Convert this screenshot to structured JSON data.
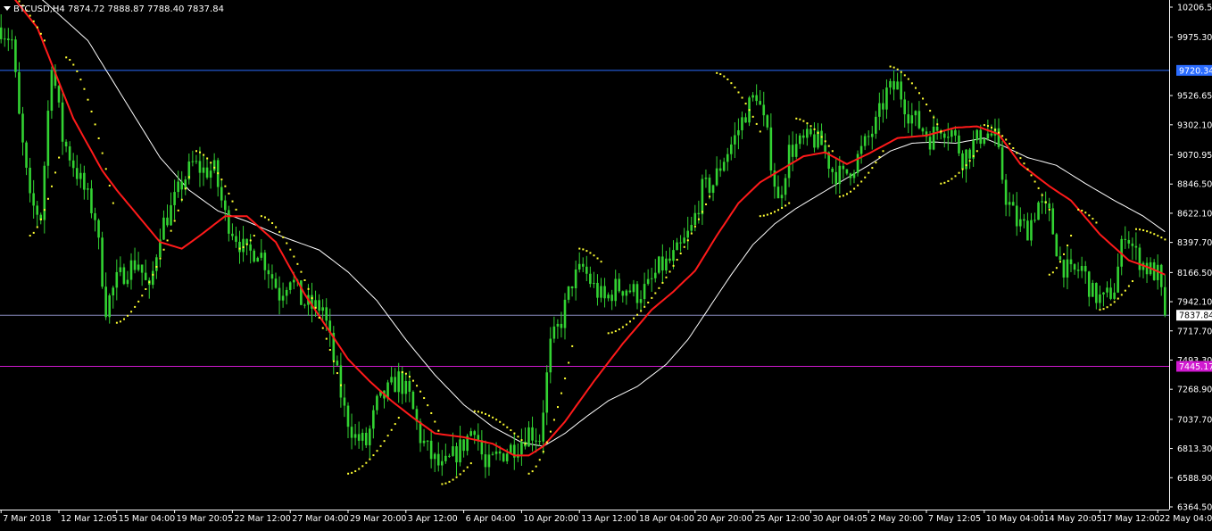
{
  "window": {
    "symbol_info": "BTCUSD,H4",
    "ohlc_info": "7874.72 7888.87 7788.40 7837.84"
  },
  "colors": {
    "background": "#000000",
    "candle": "#32d232",
    "ma_fast": "#ff1a1a",
    "ma_slow": "#ffffff",
    "sar": "#ffff33",
    "hline_blue": "#2b6cff",
    "hline_price": "#8a8cbf",
    "hline_magenta": "#d11ad1",
    "text": "#ffffff"
  },
  "chart_data": {
    "type": "candlestick",
    "title": "BTCUSD,H4",
    "y_ticks": [
      "10206.50",
      "9975.30",
      "9526.65",
      "9302.10",
      "9070.95",
      "8846.50",
      "8622.10",
      "8397.70",
      "8166.50",
      "7942.10",
      "7717.70",
      "7493.30",
      "7268.90",
      "7037.70",
      "6813.30",
      "6588.90",
      "6364.50"
    ],
    "y_tick_values": [
      10206.5,
      9975.3,
      9526.65,
      9302.1,
      9070.95,
      8846.5,
      8622.1,
      8397.7,
      8166.5,
      7942.1,
      7717.7,
      7493.3,
      7268.9,
      7037.7,
      6813.3,
      6588.9,
      6364.5
    ],
    "ylim": [
      6364.5,
      10206.5
    ],
    "x_tick_labels": [
      "7 Mar 2018",
      "12 Mar 12:05",
      "15 Mar 04:00",
      "19 Mar 20:05",
      "22 Mar 12:00",
      "27 Mar 04:00",
      "29 Mar 20:00",
      "3 Apr 12:00",
      "6 Apr 04:00",
      "10 Apr 20:00",
      "13 Apr 12:00",
      "18 Apr 04:00",
      "20 Apr 20:00",
      "25 Apr 12:00",
      "30 Apr 04:05",
      "2 May 20:00",
      "7 May 12:05",
      "10 May 04:00",
      "14 May 20:05",
      "17 May 12:00",
      "22 May 04:00"
    ],
    "x_tick_bar_index": [
      0,
      16,
      32,
      48,
      64,
      80,
      96,
      112,
      128,
      144,
      160,
      176,
      192,
      208,
      224,
      240,
      256,
      272,
      288,
      304,
      320
    ],
    "horizontal_lines": [
      {
        "label": "9720.34",
        "value": 9720.34,
        "color": "#2b6cff",
        "badge_bg": "#2b6cff",
        "badge_fg": "#ffffff"
      },
      {
        "label": "7837.84",
        "value": 7837.84,
        "color": "#8a8cbf",
        "badge_bg": "#ffffff",
        "badge_fg": "#000000"
      },
      {
        "label": "7445.17",
        "value": 7445.17,
        "color": "#d11ad1",
        "badge_bg": "#d11ad1",
        "badge_fg": "#ffffff"
      }
    ],
    "close_anchors": [
      [
        0,
        10050
      ],
      [
        3,
        9950
      ],
      [
        5,
        9350
      ],
      [
        8,
        8700
      ],
      [
        11,
        8600
      ],
      [
        14,
        9800
      ],
      [
        17,
        9200
      ],
      [
        20,
        9000
      ],
      [
        23,
        8800
      ],
      [
        26,
        8600
      ],
      [
        29,
        7900
      ],
      [
        32,
        8100
      ],
      [
        35,
        8200
      ],
      [
        38,
        8250
      ],
      [
        41,
        8000
      ],
      [
        44,
        8500
      ],
      [
        47,
        8650
      ],
      [
        50,
        8850
      ],
      [
        53,
        9000
      ],
      [
        56,
        8950
      ],
      [
        59,
        8950
      ],
      [
        62,
        8600
      ],
      [
        65,
        8450
      ],
      [
        68,
        8300
      ],
      [
        71,
        8350
      ],
      [
        74,
        8200
      ],
      [
        77,
        8000
      ],
      [
        80,
        8150
      ],
      [
        83,
        7950
      ],
      [
        86,
        7900
      ],
      [
        89,
        7900
      ],
      [
        92,
        7500
      ],
      [
        95,
        7100
      ],
      [
        98,
        6900
      ],
      [
        101,
        6850
      ],
      [
        104,
        7150
      ],
      [
        107,
        7250
      ],
      [
        110,
        7350
      ],
      [
        113,
        7200
      ],
      [
        116,
        6900
      ],
      [
        119,
        6750
      ],
      [
        122,
        6650
      ],
      [
        125,
        6750
      ],
      [
        128,
        6850
      ],
      [
        131,
        7000
      ],
      [
        134,
        6650
      ],
      [
        137,
        6750
      ],
      [
        140,
        6800
      ],
      [
        143,
        6850
      ],
      [
        146,
        6950
      ],
      [
        149,
        6900
      ],
      [
        152,
        7600
      ],
      [
        155,
        7800
      ],
      [
        158,
        8100
      ],
      [
        161,
        8200
      ],
      [
        164,
        8050
      ],
      [
        167,
        7950
      ],
      [
        170,
        8050
      ],
      [
        173,
        8050
      ],
      [
        176,
        8000
      ],
      [
        179,
        8050
      ],
      [
        182,
        8200
      ],
      [
        185,
        8250
      ],
      [
        188,
        8350
      ],
      [
        191,
        8500
      ],
      [
        194,
        8800
      ],
      [
        197,
        8850
      ],
      [
        200,
        9050
      ],
      [
        203,
        9200
      ],
      [
        206,
        9400
      ],
      [
        209,
        9550
      ],
      [
        212,
        9200
      ],
      [
        215,
        8700
      ],
      [
        218,
        9100
      ],
      [
        221,
        9150
      ],
      [
        224,
        9200
      ],
      [
        227,
        9150
      ],
      [
        230,
        8950
      ],
      [
        233,
        8900
      ],
      [
        236,
        9000
      ],
      [
        239,
        9150
      ],
      [
        242,
        9300
      ],
      [
        245,
        9550
      ],
      [
        248,
        9600
      ],
      [
        251,
        9400
      ],
      [
        254,
        9300
      ],
      [
        257,
        9200
      ],
      [
        260,
        9300
      ],
      [
        263,
        9250
      ],
      [
        266,
        9050
      ],
      [
        269,
        9150
      ],
      [
        272,
        9250
      ],
      [
        275,
        9200
      ],
      [
        278,
        8750
      ],
      [
        281,
        8550
      ],
      [
        284,
        8500
      ],
      [
        287,
        8700
      ],
      [
        290,
        8600
      ],
      [
        293,
        8250
      ],
      [
        296,
        8150
      ],
      [
        299,
        8200
      ],
      [
        302,
        8000
      ],
      [
        305,
        7950
      ],
      [
        308,
        8050
      ],
      [
        311,
        8500
      ],
      [
        314,
        8300
      ],
      [
        317,
        8200
      ],
      [
        320,
        8150
      ],
      [
        322,
        7837.84
      ]
    ],
    "ma_fast_anchors": [
      [
        0,
        10400
      ],
      [
        10,
        10050
      ],
      [
        20,
        9350
      ],
      [
        28,
        8950
      ],
      [
        32,
        8800
      ],
      [
        38,
        8600
      ],
      [
        44,
        8400
      ],
      [
        50,
        8350
      ],
      [
        55,
        8450
      ],
      [
        62,
        8600
      ],
      [
        68,
        8600
      ],
      [
        76,
        8400
      ],
      [
        84,
        8000
      ],
      [
        90,
        7750
      ],
      [
        96,
        7500
      ],
      [
        102,
        7330
      ],
      [
        108,
        7180
      ],
      [
        114,
        7050
      ],
      [
        120,
        6930
      ],
      [
        128,
        6900
      ],
      [
        136,
        6850
      ],
      [
        142,
        6760
      ],
      [
        146,
        6760
      ],
      [
        150,
        6830
      ],
      [
        156,
        7020
      ],
      [
        164,
        7330
      ],
      [
        172,
        7620
      ],
      [
        180,
        7880
      ],
      [
        186,
        8020
      ],
      [
        192,
        8180
      ],
      [
        198,
        8450
      ],
      [
        204,
        8700
      ],
      [
        210,
        8860
      ],
      [
        216,
        8960
      ],
      [
        222,
        9060
      ],
      [
        228,
        9090
      ],
      [
        234,
        9000
      ],
      [
        240,
        9080
      ],
      [
        248,
        9200
      ],
      [
        256,
        9220
      ],
      [
        264,
        9280
      ],
      [
        270,
        9290
      ],
      [
        276,
        9230
      ],
      [
        282,
        9000
      ],
      [
        290,
        8830
      ],
      [
        296,
        8720
      ],
      [
        304,
        8460
      ],
      [
        312,
        8260
      ],
      [
        318,
        8200
      ],
      [
        322,
        8150
      ]
    ],
    "ma_slow_anchors": [
      [
        0,
        10500
      ],
      [
        12,
        10250
      ],
      [
        24,
        9950
      ],
      [
        34,
        9500
      ],
      [
        44,
        9050
      ],
      [
        52,
        8800
      ],
      [
        60,
        8640
      ],
      [
        68,
        8560
      ],
      [
        78,
        8440
      ],
      [
        88,
        8340
      ],
      [
        96,
        8170
      ],
      [
        104,
        7950
      ],
      [
        112,
        7650
      ],
      [
        120,
        7380
      ],
      [
        128,
        7150
      ],
      [
        136,
        6980
      ],
      [
        144,
        6860
      ],
      [
        150,
        6830
      ],
      [
        156,
        6930
      ],
      [
        162,
        7060
      ],
      [
        168,
        7180
      ],
      [
        176,
        7290
      ],
      [
        184,
        7460
      ],
      [
        190,
        7650
      ],
      [
        196,
        7900
      ],
      [
        202,
        8150
      ],
      [
        208,
        8380
      ],
      [
        214,
        8540
      ],
      [
        220,
        8660
      ],
      [
        226,
        8760
      ],
      [
        232,
        8860
      ],
      [
        240,
        8990
      ],
      [
        246,
        9100
      ],
      [
        252,
        9160
      ],
      [
        258,
        9170
      ],
      [
        264,
        9160
      ],
      [
        272,
        9200
      ],
      [
        278,
        9130
      ],
      [
        284,
        9050
      ],
      [
        292,
        8990
      ],
      [
        300,
        8850
      ],
      [
        308,
        8720
      ],
      [
        316,
        8600
      ],
      [
        322,
        8480
      ]
    ],
    "sar_segments": [
      {
        "from": 0,
        "to": 12,
        "dir": "down",
        "start": 10350,
        "end": 9950
      },
      {
        "from": 8,
        "to": 16,
        "dir": "up",
        "start": 8450,
        "end": 9050
      },
      {
        "from": 18,
        "to": 31,
        "dir": "down",
        "start": 9820,
        "end": 8700
      },
      {
        "from": 32,
        "to": 52,
        "dir": "up",
        "start": 7780,
        "end": 8900
      },
      {
        "from": 54,
        "to": 65,
        "dir": "down",
        "start": 9100,
        "end": 8650
      },
      {
        "from": 66,
        "to": 70,
        "dir": "up",
        "start": 8350,
        "end": 8450
      },
      {
        "from": 72,
        "to": 94,
        "dir": "down",
        "start": 8600,
        "end": 7300
      },
      {
        "from": 96,
        "to": 110,
        "dir": "up",
        "start": 6620,
        "end": 7050
      },
      {
        "from": 111,
        "to": 121,
        "dir": "down",
        "start": 7400,
        "end": 6950
      },
      {
        "from": 122,
        "to": 130,
        "dir": "up",
        "start": 6540,
        "end": 6700
      },
      {
        "from": 131,
        "to": 145,
        "dir": "down",
        "start": 7100,
        "end": 6850
      },
      {
        "from": 146,
        "to": 158,
        "dir": "up",
        "start": 6620,
        "end": 7600
      },
      {
        "from": 160,
        "to": 166,
        "dir": "down",
        "start": 8350,
        "end": 8250
      },
      {
        "from": 168,
        "to": 196,
        "dir": "up",
        "start": 7700,
        "end": 8750
      },
      {
        "from": 198,
        "to": 210,
        "dir": "down",
        "start": 9700,
        "end": 9250
      },
      {
        "from": 210,
        "to": 218,
        "dir": "up",
        "start": 8600,
        "end": 8700
      },
      {
        "from": 220,
        "to": 230,
        "dir": "down",
        "start": 9350,
        "end": 9100
      },
      {
        "from": 232,
        "to": 244,
        "dir": "up",
        "start": 8750,
        "end": 9100
      },
      {
        "from": 246,
        "to": 260,
        "dir": "down",
        "start": 9750,
        "end": 9250
      },
      {
        "from": 260,
        "to": 270,
        "dir": "up",
        "start": 8850,
        "end": 9100
      },
      {
        "from": 272,
        "to": 290,
        "dir": "down",
        "start": 9300,
        "end": 8650
      },
      {
        "from": 290,
        "to": 296,
        "dir": "up",
        "start": 8150,
        "end": 8450
      },
      {
        "from": 298,
        "to": 303,
        "dir": "down",
        "start": 8650,
        "end": 8550
      },
      {
        "from": 304,
        "to": 313,
        "dir": "up",
        "start": 7880,
        "end": 8100
      },
      {
        "from": 314,
        "to": 322,
        "dir": "down",
        "start": 8500,
        "end": 8420
      }
    ]
  }
}
